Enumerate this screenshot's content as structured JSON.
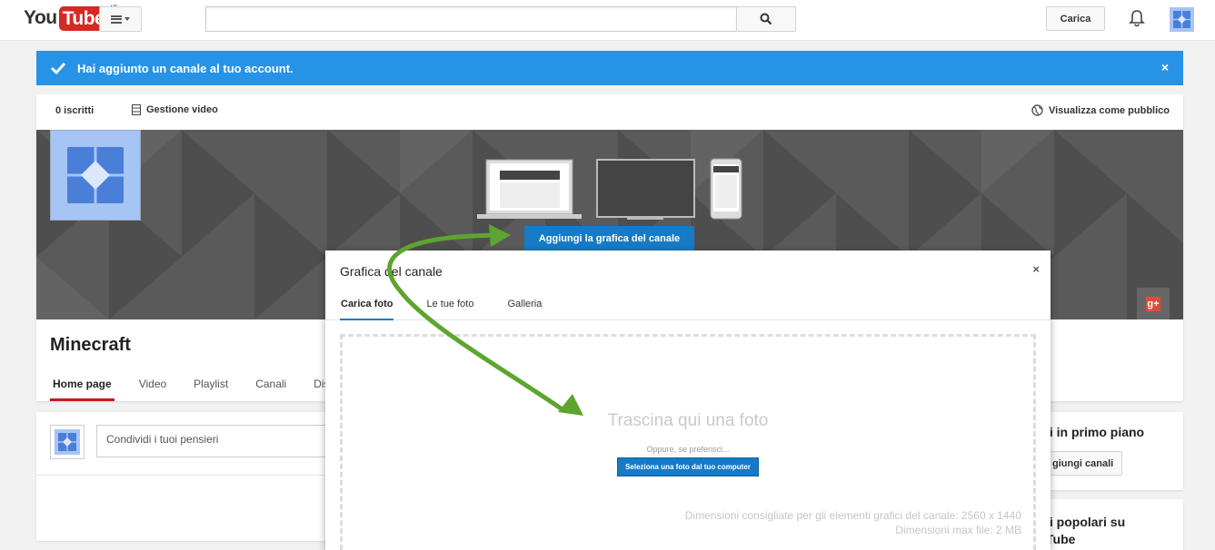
{
  "masthead": {
    "logo_you": "You",
    "logo_tube": "Tube",
    "logo_region": "IT",
    "upload_label": "Carica",
    "search_placeholder": ""
  },
  "alert": {
    "message": "Hai aggiunto un canale al tuo account.",
    "close_label": "×",
    "color": "#2793e6"
  },
  "channel": {
    "subscribers": "0 iscritti",
    "manage_videos": "Gestione video",
    "view_as_public": "Visualizza come pubblico",
    "add_art_label": "Aggiungi la grafica del canale",
    "gplus_label": "g+",
    "name": "Minecraft",
    "tabs": [
      {
        "label": "Home page",
        "active": true
      },
      {
        "label": "Video"
      },
      {
        "label": "Playlist"
      },
      {
        "label": "Canali"
      },
      {
        "label": "Dis"
      }
    ]
  },
  "feed": {
    "share_placeholder": "Condividi i tuoi pensieri"
  },
  "sidebar": {
    "featured_title": "li in primo piano",
    "add_channels_label": "giungi canali",
    "popular_title": "li popolari su\nTube"
  },
  "modal": {
    "title": "Grafica del canale",
    "close_label": "×",
    "tabs": [
      {
        "label": "Carica foto",
        "active": true
      },
      {
        "label": "Le tue foto"
      },
      {
        "label": "Galleria"
      }
    ],
    "drop_text": "Trascina qui una foto",
    "or_text": "Oppure, se preferisci...",
    "select_button": "Seleziona una foto dal tuo computer",
    "recommended_size": "Dimensioni consigliate per gli elementi grafici del canale: 2560 x 1440",
    "max_file_size": "Dimensioni max file: 2 MB"
  },
  "colors": {
    "brand_red": "#d42a23",
    "primary_blue": "#167ac6",
    "annotation_green": "#5da52e"
  }
}
